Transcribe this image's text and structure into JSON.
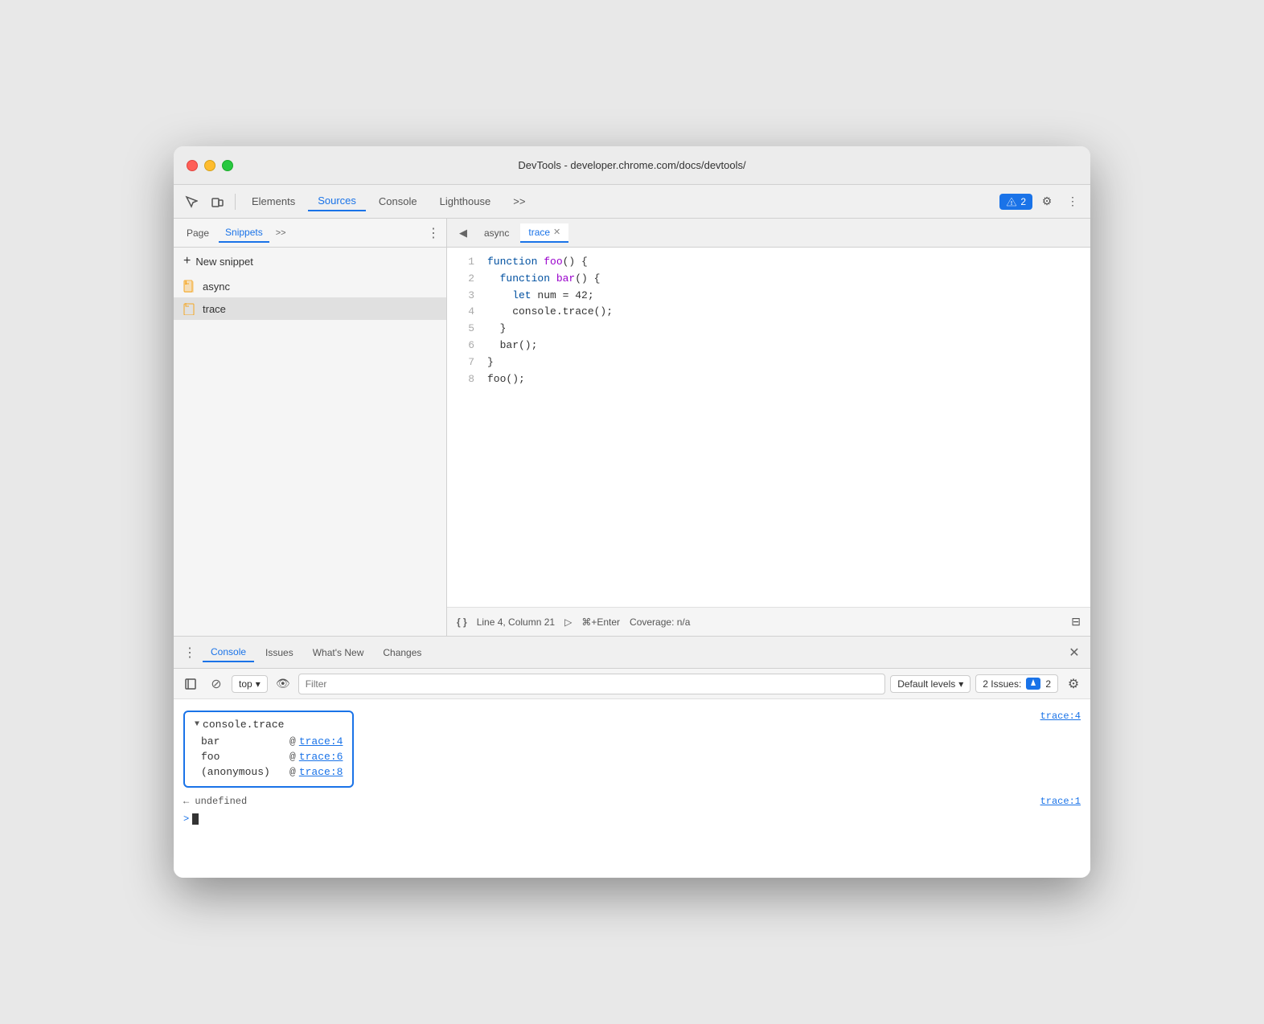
{
  "window": {
    "title": "DevTools - developer.chrome.com/docs/devtools/"
  },
  "toolbar": {
    "tabs": [
      {
        "label": "Elements",
        "active": false
      },
      {
        "label": "Sources",
        "active": true
      },
      {
        "label": "Console",
        "active": false
      },
      {
        "label": "Lighthouse",
        "active": false
      }
    ],
    "more_label": ">>",
    "badge_count": "2",
    "settings_label": "⚙",
    "more_icon": "⋮"
  },
  "sidebar": {
    "tabs": [
      {
        "label": "Page",
        "active": false
      },
      {
        "label": "Snippets",
        "active": true
      }
    ],
    "more_label": ">>",
    "menu_label": "⋮",
    "new_snippet_label": "New snippet",
    "snippets": [
      {
        "name": "async",
        "active": false
      },
      {
        "name": "trace",
        "active": true
      }
    ]
  },
  "editor": {
    "tabs": [
      {
        "label": "async",
        "active": false,
        "closeable": false
      },
      {
        "label": "trace",
        "active": true,
        "closeable": true
      }
    ],
    "toggle_sidebar_label": "◀",
    "lines": [
      {
        "num": 1,
        "code": "function foo() {",
        "parts": [
          {
            "text": "function ",
            "cls": "kw-blue"
          },
          {
            "text": "foo",
            "cls": "kw-purple"
          },
          {
            "text": "() {",
            "cls": "kw-dark"
          }
        ]
      },
      {
        "num": 2,
        "code": "  function bar() {",
        "parts": [
          {
            "text": "  function ",
            "cls": "kw-blue"
          },
          {
            "text": "bar",
            "cls": "kw-purple"
          },
          {
            "text": "() {",
            "cls": "kw-dark"
          }
        ]
      },
      {
        "num": 3,
        "code": "    let num = 42;",
        "parts": [
          {
            "text": "    let ",
            "cls": "kw-blue"
          },
          {
            "text": "num",
            "cls": "kw-dark"
          },
          {
            "text": " = 42;",
            "cls": "kw-dark"
          }
        ]
      },
      {
        "num": 4,
        "code": "    console.trace();",
        "parts": [
          {
            "text": "    console.trace();",
            "cls": "kw-dark"
          }
        ]
      },
      {
        "num": 5,
        "code": "  }",
        "parts": [
          {
            "text": "  }",
            "cls": "kw-dark"
          }
        ]
      },
      {
        "num": 6,
        "code": "  bar();",
        "parts": [
          {
            "text": "  bar();",
            "cls": "kw-dark"
          }
        ]
      },
      {
        "num": 7,
        "code": "}",
        "parts": [
          {
            "text": "}",
            "cls": "kw-dark"
          }
        ]
      },
      {
        "num": 8,
        "code": "foo();",
        "parts": [
          {
            "text": "foo();",
            "cls": "kw-dark"
          }
        ]
      }
    ],
    "status": {
      "braces": "{ }",
      "position": "Line 4, Column 21",
      "run_icon": "▷",
      "run_shortcut": "⌘+Enter",
      "coverage": "Coverage: n/a",
      "screenshot_icon": "⊟"
    }
  },
  "console": {
    "tabs": [
      {
        "label": "Console",
        "active": true
      },
      {
        "label": "Issues",
        "active": false
      },
      {
        "label": "What's New",
        "active": false
      },
      {
        "label": "Changes",
        "active": false
      }
    ],
    "menu_label": "⋮",
    "close_label": "✕",
    "toolbar": {
      "sidebar_btn": "▶|",
      "clear_btn": "⊘",
      "top_selector": "top",
      "eye_btn": "👁",
      "filter_placeholder": "Filter",
      "default_levels": "Default levels",
      "issues_label": "2 Issues:",
      "issues_count": "2",
      "settings_label": "⚙"
    },
    "trace_output": {
      "header": "console.trace",
      "location": "trace:4",
      "rows": [
        {
          "fn": "bar",
          "at": "@",
          "link": "trace:4"
        },
        {
          "fn": "foo",
          "at": "@",
          "link": "trace:6"
        },
        {
          "fn": "(anonymous)",
          "at": "@",
          "link": "trace:8"
        }
      ]
    },
    "undefined_line": "← undefined",
    "undefined_location": "trace:1",
    "prompt": ">"
  }
}
